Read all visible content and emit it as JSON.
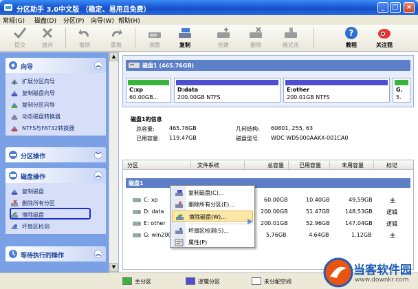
{
  "window": {
    "title": "分区助手 3.0中文版 （稳定、易用且免费）",
    "min": "_",
    "max": "□",
    "close": "×"
  },
  "menu": [
    "常规(G)",
    "磁盘(D)",
    "分区(P)",
    "向导(W)",
    "帮助(H)"
  ],
  "toolbar": [
    {
      "label": "提交",
      "icon": "check-icon",
      "disabled": true
    },
    {
      "label": "放弃",
      "icon": "discard-icon",
      "disabled": true
    },
    {
      "label": "撤销",
      "icon": "undo-icon",
      "disabled": true
    },
    {
      "label": "重做",
      "icon": "redo-icon",
      "disabled": true
    },
    {
      "label": "调整",
      "icon": "resize-icon",
      "disabled": true
    },
    {
      "label": "复制",
      "icon": "copy-disk-icon",
      "disabled": false
    },
    {
      "label": "创建",
      "icon": "create-icon",
      "disabled": true
    },
    {
      "label": "删除",
      "icon": "delete-icon",
      "disabled": true
    },
    {
      "label": "格式化",
      "icon": "format-icon",
      "disabled": true
    },
    {
      "label": "教程",
      "icon": "help-icon",
      "disabled": false
    },
    {
      "label": "关注我",
      "icon": "follow-icon",
      "disabled": false
    }
  ],
  "left": {
    "wizard": {
      "title": "向导",
      "items": [
        "扩展分区向导",
        "复制磁盘向导",
        "复制分区向导",
        "动态磁盘转换器",
        "NTFS与FAT32转换器"
      ]
    },
    "partition_ops": {
      "title": "分区操作"
    },
    "disk_ops": {
      "title": "磁盘操作",
      "items": [
        "复制磁盘",
        "删除所有分区",
        "擦除磁盘",
        "坏扇区检测"
      ]
    },
    "pending": {
      "title": "等待执行的操作"
    }
  },
  "diskmap": {
    "header": "磁盘1 (465.76GB)",
    "partitions": [
      {
        "name": "C:xp",
        "size": "60.00GB...",
        "color": "#3bb43b"
      },
      {
        "name": "D:data",
        "size": "200.00GB NTFS",
        "color": "#4b4fd0"
      },
      {
        "name": "E:other",
        "size": "200.01GB NTFS",
        "color": "#4b4fd0"
      },
      {
        "name": "G.",
        "size": "5.",
        "color": "#3bb43b"
      }
    ]
  },
  "info": {
    "title": "磁盘1的信息",
    "total_label": "总容量:",
    "total": "465.76GB",
    "used_label": "已用容量:",
    "used": "119.47GB",
    "geometry_label": "几何结构:",
    "geometry": "60801, 255, 63",
    "model_label": "磁盘型号:",
    "model": "WDC WD5000AAKX-001CA0"
  },
  "table": {
    "headers": [
      "分区",
      "文件系统",
      "总容量",
      "已用容量",
      "未用容量",
      "标记"
    ],
    "disk_label": "磁盘1",
    "rows": [
      {
        "part": "C: xp",
        "total": "60.00GB",
        "used": "10.40GB",
        "free": "49.59GB",
        "flag": "主"
      },
      {
        "part": "D: data",
        "total": "200.00GB",
        "used": "51.47GB",
        "free": "148.53GB",
        "flag": "逻辑"
      },
      {
        "part": "E: other",
        "total": "200.01GB",
        "used": "52.96GB",
        "free": "147.04GB",
        "flag": "逻辑"
      },
      {
        "part": "G: win200",
        "total": "5.76GB",
        "used": "4.64GB",
        "free": "1.12GB",
        "flag": "主"
      }
    ]
  },
  "context_menu": [
    {
      "label": "复制磁盘(C)...",
      "icon": "copy-disk-icon"
    },
    {
      "label": "删除所有分区(E)...",
      "icon": "delete-all-icon"
    },
    {
      "label": "擦除磁盘(W)...",
      "icon": "wipe-icon",
      "highlight": true
    },
    {
      "label": "坏扇区检测(S)...",
      "icon": "bad-sector-icon"
    },
    {
      "label": "属性(P)",
      "icon": "properties-icon"
    }
  ],
  "legend": [
    {
      "label": "主分区",
      "color": "#3bb43b"
    },
    {
      "label": "逻辑分区",
      "color": "#4b4fd0"
    },
    {
      "label": "未分配空间",
      "color": "#ffffff"
    }
  ],
  "watermark": {
    "title": "当客软件园",
    "url": "www.downkr.com"
  }
}
